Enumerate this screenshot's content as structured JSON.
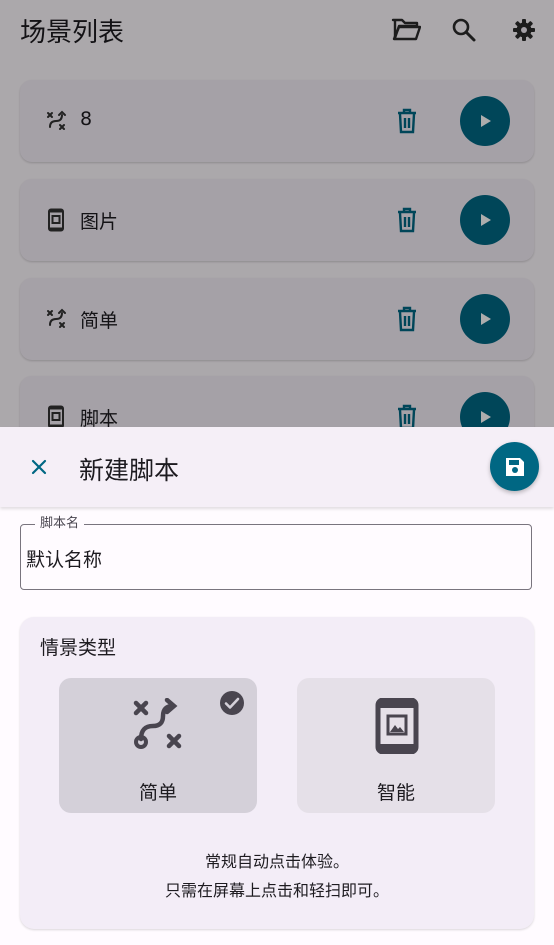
{
  "app_bar": {
    "title": "场景列表",
    "actions": [
      "folder-open-icon",
      "search-icon",
      "gear-icon"
    ]
  },
  "scene_list": [
    {
      "name": "8",
      "type_icon": "shuffle-icon"
    },
    {
      "name": "图片",
      "type_icon": "phone-image-icon"
    },
    {
      "name": "简单",
      "type_icon": "shuffle-icon"
    },
    {
      "name": "脚本",
      "type_icon": "phone-image-icon"
    }
  ],
  "sheet": {
    "title": "新建脚本",
    "name_field": {
      "label": "脚本名",
      "value": "默认名称"
    },
    "scene_type": {
      "label": "情景类型",
      "options": [
        {
          "label": "简单",
          "icon": "route-icon",
          "selected": true
        },
        {
          "label": "智能",
          "icon": "phone-image-icon",
          "selected": false
        }
      ],
      "description_line1": "常规自动点击体验。",
      "description_line2": "只需在屏幕上点击和轻扫即可。"
    }
  },
  "colors": {
    "accent": "#006783",
    "selected_option": "#d4d0d9",
    "option": "#e5e0e8",
    "sheet_header": "#f5eff7",
    "card": "#f3edf7"
  }
}
